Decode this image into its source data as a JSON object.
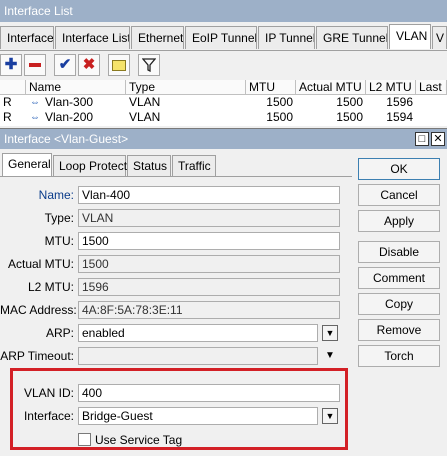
{
  "window": {
    "title": "Interface List"
  },
  "tabs": [
    "Interface",
    "Interface List",
    "Ethernet",
    "EoIP Tunnel",
    "IP Tunnel",
    "GRE Tunnel",
    "VLAN",
    "V"
  ],
  "toolbar": {
    "icons": [
      "add-icon",
      "remove-icon",
      "enable-icon",
      "disable-icon",
      "comment-icon",
      "filter-icon"
    ]
  },
  "grid": {
    "columns": [
      "Name",
      "Type",
      "MTU",
      "Actual MTU",
      "L2 MTU",
      "Last L"
    ],
    "rows": [
      {
        "flag": "R",
        "name": "Vlan-300",
        "type": "VLAN",
        "mtu": "1500",
        "actual_mtu": "1500",
        "l2_mtu": "1596"
      },
      {
        "flag": "R",
        "name": "Vlan-200",
        "type": "VLAN",
        "mtu": "1500",
        "actual_mtu": "1500",
        "l2_mtu": "1594"
      }
    ]
  },
  "dialog": {
    "title": "Interface <Vlan-Guest>",
    "tabs": [
      "General",
      "Loop Protect",
      "Status",
      "Traffic"
    ],
    "fields": {
      "name": {
        "label": "Name:",
        "value": "Vlan-400"
      },
      "type": {
        "label": "Type:",
        "value": "VLAN"
      },
      "mtu": {
        "label": "MTU:",
        "value": "1500"
      },
      "actual_mtu": {
        "label": "Actual MTU:",
        "value": "1500"
      },
      "l2_mtu": {
        "label": "L2 MTU:",
        "value": "1596"
      },
      "mac": {
        "label": "MAC Address:",
        "value": "4A:8F:5A:78:3E:11"
      },
      "arp": {
        "label": "ARP:",
        "value": "enabled"
      },
      "arp_timeout": {
        "label": "ARP Timeout:",
        "value": ""
      },
      "vlan_id": {
        "label": "VLAN ID:",
        "value": "400"
      },
      "interface": {
        "label": "Interface:",
        "value": "Bridge-Guest"
      },
      "service_tag": {
        "label": "Use Service Tag",
        "checked": false
      }
    },
    "buttons": [
      "OK",
      "Cancel",
      "Apply",
      "Disable",
      "Comment",
      "Copy",
      "Remove",
      "Torch"
    ]
  },
  "colors": {
    "titlebar": "#9db0c8",
    "highlight": "#d32026",
    "name_label": "#0b3c8a"
  }
}
